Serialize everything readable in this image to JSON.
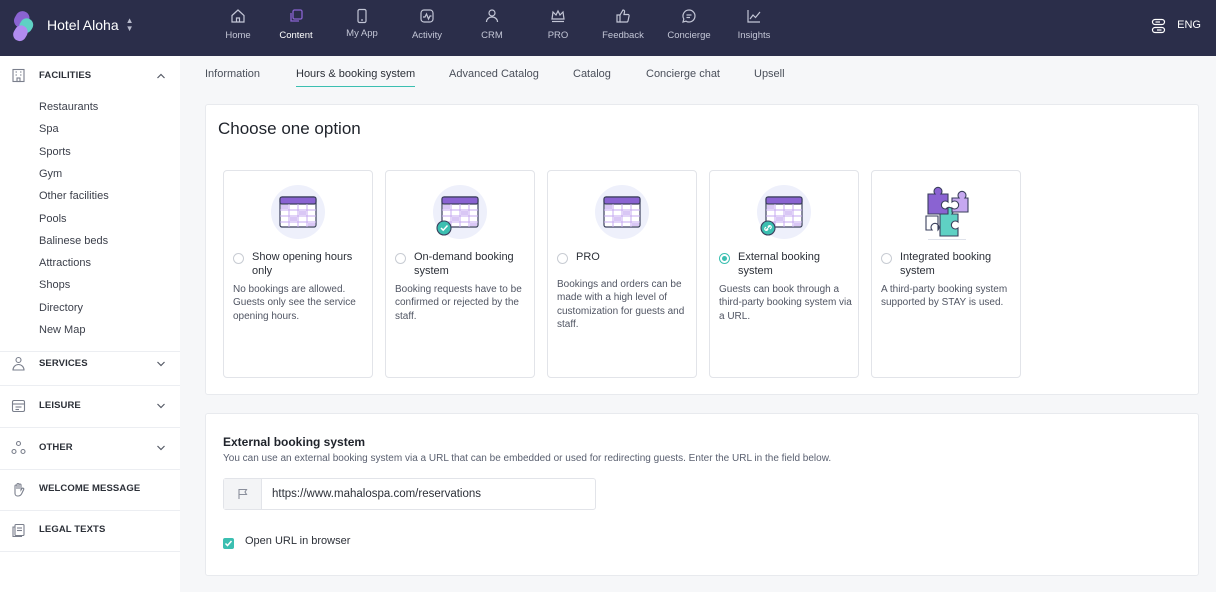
{
  "app": {
    "hotel_name": "Hotel Aloha",
    "language": "ENG"
  },
  "colors": {
    "topbar": "#2b2e4a",
    "accent": "#3bbfb1",
    "purple": "#8a63d2"
  },
  "nav": [
    {
      "label": "Home",
      "icon": "home-icon"
    },
    {
      "label": "Content",
      "icon": "content-icon"
    },
    {
      "label": "My App",
      "icon": "phone-icon"
    },
    {
      "label": "Activity",
      "icon": "activity-icon"
    },
    {
      "label": "CRM",
      "icon": "users-icon"
    },
    {
      "label": "PRO",
      "icon": "crown-icon"
    },
    {
      "label": "Feedback",
      "icon": "thumbs-up-icon"
    },
    {
      "label": "Concierge",
      "icon": "chat-icon"
    },
    {
      "label": "Insights",
      "icon": "chart-icon"
    }
  ],
  "sidebar": {
    "facilities": {
      "title": "FACILITIES",
      "items": [
        "Restaurants",
        "Spa",
        "Sports",
        "Gym",
        "Other facilities",
        "Pools",
        "Balinese beds",
        "Attractions",
        "Shops",
        "Directory",
        "New Map"
      ]
    },
    "services": "SERVICES",
    "leisure": "LEISURE",
    "other": "OTHER",
    "welcome": "WELCOME MESSAGE",
    "legal": "LEGAL TEXTS"
  },
  "tabs": [
    "Information",
    "Hours & booking system",
    "Advanced Catalog",
    "Catalog",
    "Concierge chat",
    "Upsell"
  ],
  "main": {
    "heading": "Choose one option",
    "options": [
      {
        "title": "Show opening hours only",
        "desc": "No bookings are allowed. Guests only see the service opening hours.",
        "selected": false
      },
      {
        "title": "On-demand booking system",
        "desc": "Booking requests have to be confirmed or rejected by the staff.",
        "selected": false
      },
      {
        "title": "PRO",
        "desc": "Bookings and orders can be made with a high level of customization for guests and staff.",
        "selected": false
      },
      {
        "title": "External booking system",
        "desc": "Guests can book through a third-party booking system via a URL.",
        "selected": true
      },
      {
        "title": "Integrated booking system",
        "desc": "A third-party booking system supported by STAY is used.",
        "selected": false
      }
    ]
  },
  "external": {
    "title": "External booking system",
    "description": "You can use an external booking system via a URL that can be embedded or used for redirecting guests. Enter the URL in the field below.",
    "url": "https://www.mahalospa.com/reservations",
    "checkbox_label": "Open URL in browser",
    "checkbox_checked": true
  }
}
